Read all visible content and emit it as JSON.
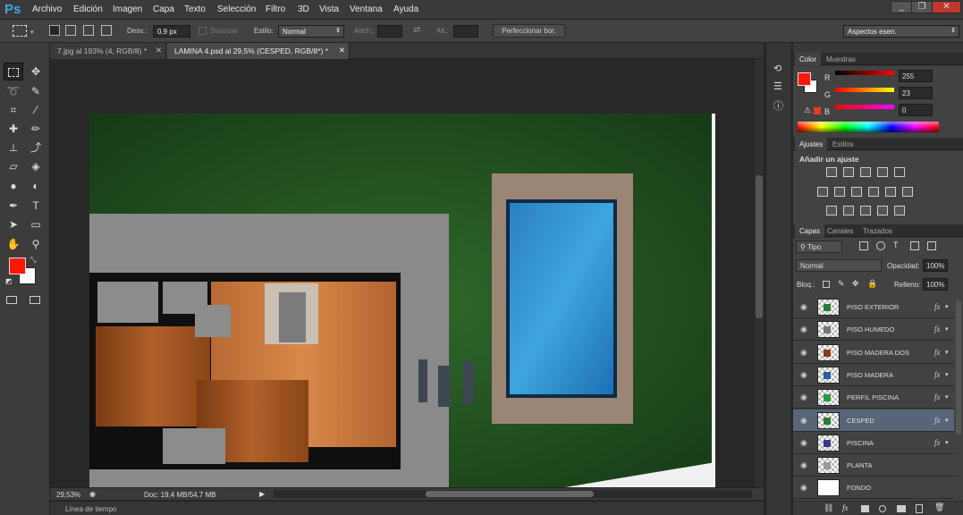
{
  "app": {
    "logo": "Ps"
  },
  "menu": [
    "Archivo",
    "Edición",
    "Imagen",
    "Capa",
    "Texto",
    "Selección",
    "Filtro",
    "3D",
    "Vista",
    "Ventana",
    "Ayuda"
  ],
  "window_controls": [
    "_",
    "❐",
    "✕"
  ],
  "options": {
    "desv_label": "Desv.:",
    "desv_value": "0,9 px",
    "suavizar_label": "Suavizar",
    "estilo_label": "Estilo:",
    "estilo_value": "Normal",
    "anch_label": "Anch.:",
    "alt_label": "Alt.:",
    "refine_button": "Perfeccionar bor.",
    "workspace": "Aspectos esen."
  },
  "tabs": [
    {
      "label": "7.jpg al 193% (4, RGB/8) *",
      "active": false
    },
    {
      "label": "LAMINA 4.psd al 29,5% (CESPED, RGB/8*) *",
      "active": true
    }
  ],
  "status": {
    "zoom": "29,53%",
    "doc": "Doc: 19,4 MB/54,7 MB"
  },
  "timeline_label": "Línea de tiempo",
  "color_panel": {
    "tabs": [
      "Color",
      "Muestras"
    ],
    "fg_color": "#ff1700",
    "channels": [
      {
        "label": "R",
        "value": "255"
      },
      {
        "label": "G",
        "value": "23"
      },
      {
        "label": "B",
        "value": "0"
      }
    ]
  },
  "adjust_panel": {
    "tabs": [
      "Ajustes",
      "Estilos"
    ],
    "title": "Añadir un ajuste"
  },
  "layers_panel": {
    "tabs": [
      "Capas",
      "Canales",
      "Trazados"
    ],
    "filter": "Tipo",
    "blend": "Normal",
    "opacity_label": "Opacidad:",
    "opacity": "100%",
    "lock_label": "Bloq.:",
    "fill_label": "Relleno:",
    "fill": "100%",
    "fx_symbol": "fx",
    "layers": [
      {
        "name": "PISO EXTERIOR",
        "fx": true,
        "selected": false
      },
      {
        "name": "PISO HUMEDO",
        "fx": true,
        "selected": false
      },
      {
        "name": "PISO MADERA DOS",
        "fx": true,
        "selected": false
      },
      {
        "name": "PISO MADERA",
        "fx": true,
        "selected": false
      },
      {
        "name": "PERFIL PISCINA",
        "fx": true,
        "selected": false
      },
      {
        "name": "CESPED",
        "fx": true,
        "selected": true
      },
      {
        "name": "PISCINA",
        "fx": true,
        "selected": false
      },
      {
        "name": "PLANTA",
        "fx": false,
        "selected": false
      },
      {
        "name": "FONDO",
        "fx": false,
        "selected": false
      }
    ]
  }
}
